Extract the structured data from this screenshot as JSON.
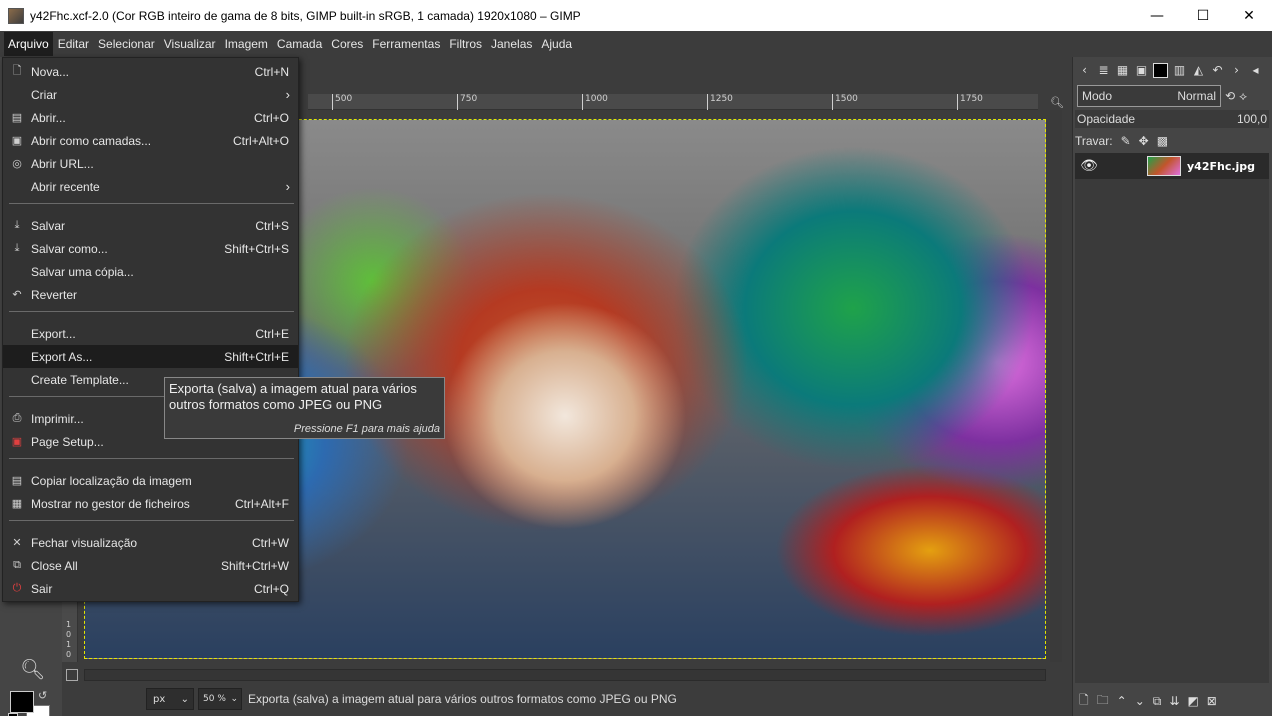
{
  "window": {
    "title": "y42Fhc.xcf-2.0 (Cor RGB inteiro de gama de 8 bits, GIMP built-in sRGB, 1 camada) 1920x1080 – GIMP",
    "minimize": "—",
    "maximize": "☐",
    "close": "✕"
  },
  "menubar": {
    "items": [
      "Arquivo",
      "Editar",
      "Selecionar",
      "Visualizar",
      "Imagem",
      "Camada",
      "Cores",
      "Ferramentas",
      "Filtros",
      "Janelas",
      "Ajuda"
    ]
  },
  "file_menu": {
    "items": [
      {
        "label": "Nova...",
        "accel": "Ctrl+N",
        "icon": "new-icon"
      },
      {
        "label": "Criar",
        "accel": "",
        "icon": "",
        "submenu": true
      },
      {
        "label": "Abrir...",
        "accel": "Ctrl+O",
        "icon": "open-icon"
      },
      {
        "label": "Abrir como camadas...",
        "accel": "Ctrl+Alt+O",
        "icon": "open-layers-icon"
      },
      {
        "label": "Abrir URL...",
        "accel": "",
        "icon": "globe-icon"
      },
      {
        "label": "Abrir recente",
        "accel": "",
        "icon": "",
        "submenu": true
      },
      {
        "label": "Salvar",
        "accel": "Ctrl+S",
        "icon": "save-icon"
      },
      {
        "label": "Salvar como...",
        "accel": "Shift+Ctrl+S",
        "icon": "save-as-icon"
      },
      {
        "label": "Salvar uma cópia...",
        "accel": "",
        "icon": ""
      },
      {
        "label": "Reverter",
        "accel": "",
        "icon": "revert-icon"
      },
      {
        "label": "Export...",
        "accel": "Ctrl+E",
        "icon": ""
      },
      {
        "label": "Export As...",
        "accel": "Shift+Ctrl+E",
        "icon": "",
        "highlighted": true
      },
      {
        "label": "Create Template...",
        "accel": "",
        "icon": ""
      },
      {
        "label": "Imprimir...",
        "accel": "",
        "icon": "print-icon"
      },
      {
        "label": "Page Setup...",
        "accel": "",
        "icon": "page-setup-icon"
      },
      {
        "label": "Copiar localização da imagem",
        "accel": "",
        "icon": "copy-location-icon"
      },
      {
        "label": "Mostrar no gestor de ficheiros",
        "accel": "Ctrl+Alt+F",
        "icon": "file-manager-icon"
      },
      {
        "label": "Fechar visualização",
        "accel": "Ctrl+W",
        "icon": "close-view-icon"
      },
      {
        "label": "Close All",
        "accel": "Shift+Ctrl+W",
        "icon": "close-all-icon"
      },
      {
        "label": "Sair",
        "accel": "Ctrl+Q",
        "icon": "quit-icon"
      }
    ]
  },
  "tooltip": {
    "text": "Exporta (salva) a imagem atual para vários outros formatos como JPEG ou PNG",
    "help": "Pressione F1 para mais ajuda"
  },
  "ruler": {
    "h_ticks": [
      "500",
      "750",
      "1000",
      "1250",
      "1500",
      "1750"
    ],
    "v_ticks": [
      "1",
      "0",
      "1",
      "0"
    ]
  },
  "statusbar": {
    "unit": "px",
    "zoom": "50 %",
    "message": "Exporta (salva) a imagem atual para vários outros formatos como JPEG ou PNG"
  },
  "layers": {
    "mode_label": "Modo",
    "mode_value": "Normal",
    "opacity_label": "Opacidade",
    "opacity_value": "100,0",
    "lock_label": "Travar:",
    "layer_name": "y42Fhc.jpg"
  }
}
